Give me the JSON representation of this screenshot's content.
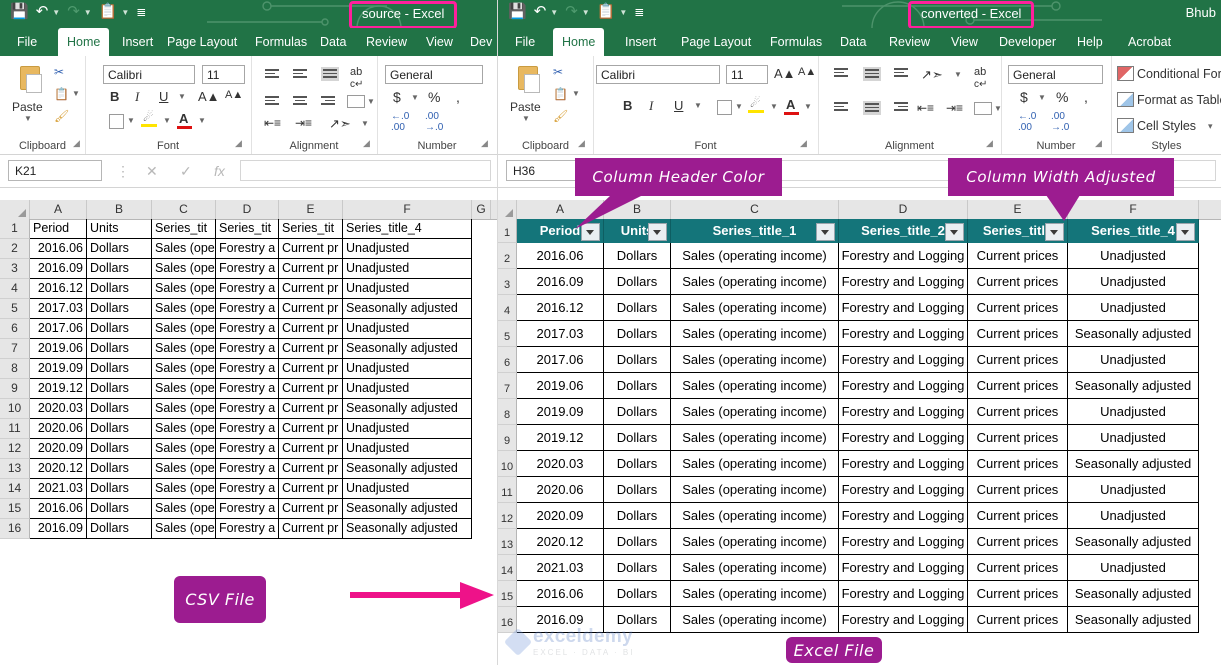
{
  "left_window": {
    "title": "source  -  Excel",
    "quick_access": [
      "save-icon",
      "undo-icon",
      "redo-icon",
      "paste-icon",
      "customize-icon"
    ],
    "tabs": [
      {
        "label": "File",
        "active": false
      },
      {
        "label": "Home",
        "active": true
      },
      {
        "label": "Insert",
        "active": false
      },
      {
        "label": "Page Layout",
        "active": false
      },
      {
        "label": "Formulas",
        "active": false
      },
      {
        "label": "Data",
        "active": false
      },
      {
        "label": "Review",
        "active": false
      },
      {
        "label": "View",
        "active": false
      },
      {
        "label": "Dev",
        "active": false
      }
    ],
    "ribbon_groups": [
      "Clipboard",
      "Font",
      "Alignment",
      "Number"
    ],
    "paste_label": "Paste",
    "font_name": "Calibri",
    "font_size": "11",
    "number_format": "General",
    "name_box": "K21",
    "formula_value": "",
    "columns": [
      "A",
      "B",
      "C",
      "D",
      "E",
      "F",
      "G"
    ],
    "row_numbers": [
      "1",
      "2",
      "3",
      "4",
      "5",
      "6",
      "7",
      "8",
      "9",
      "10",
      "11",
      "12",
      "13",
      "14",
      "15",
      "16"
    ],
    "rows": [
      [
        "Period",
        "Units",
        "Series_tit",
        "Series_tit",
        "Series_tit",
        "Series_title_4"
      ],
      [
        "2016.06",
        "Dollars",
        "Sales (ope",
        "Forestry a",
        "Current pr",
        "Unadjusted"
      ],
      [
        "2016.09",
        "Dollars",
        "Sales (ope",
        "Forestry a",
        "Current pr",
        "Unadjusted"
      ],
      [
        "2016.12",
        "Dollars",
        "Sales (ope",
        "Forestry a",
        "Current pr",
        "Unadjusted"
      ],
      [
        "2017.03",
        "Dollars",
        "Sales (ope",
        "Forestry a",
        "Current pr",
        "Seasonally adjusted"
      ],
      [
        "2017.06",
        "Dollars",
        "Sales (ope",
        "Forestry a",
        "Current pr",
        "Unadjusted"
      ],
      [
        "2019.06",
        "Dollars",
        "Sales (ope",
        "Forestry a",
        "Current pr",
        "Seasonally adjusted"
      ],
      [
        "2019.09",
        "Dollars",
        "Sales (ope",
        "Forestry a",
        "Current pr",
        "Unadjusted"
      ],
      [
        "2019.12",
        "Dollars",
        "Sales (ope",
        "Forestry a",
        "Current pr",
        "Unadjusted"
      ],
      [
        "2020.03",
        "Dollars",
        "Sales (ope",
        "Forestry a",
        "Current pr",
        "Seasonally adjusted"
      ],
      [
        "2020.06",
        "Dollars",
        "Sales (ope",
        "Forestry a",
        "Current pr",
        "Unadjusted"
      ],
      [
        "2020.09",
        "Dollars",
        "Sales (ope",
        "Forestry a",
        "Current pr",
        "Unadjusted"
      ],
      [
        "2020.12",
        "Dollars",
        "Sales (ope",
        "Forestry a",
        "Current pr",
        "Seasonally adjusted"
      ],
      [
        "2021.03",
        "Dollars",
        "Sales (ope",
        "Forestry a",
        "Current pr",
        "Unadjusted"
      ],
      [
        "2016.06",
        "Dollars",
        "Sales (ope",
        "Forestry a",
        "Current pr",
        "Seasonally adjusted"
      ],
      [
        "2016.09",
        "Dollars",
        "Sales (ope",
        "Forestry a",
        "Current pr",
        "Seasonally adjusted"
      ]
    ],
    "csv_label": "CSV File"
  },
  "right_window": {
    "title": "converted  -  Excel",
    "user_label": "Bhub",
    "tabs": [
      {
        "label": "File",
        "active": false
      },
      {
        "label": "Home",
        "active": true
      },
      {
        "label": "Insert",
        "active": false
      },
      {
        "label": "Page Layout",
        "active": false
      },
      {
        "label": "Formulas",
        "active": false
      },
      {
        "label": "Data",
        "active": false
      },
      {
        "label": "Review",
        "active": false
      },
      {
        "label": "View",
        "active": false
      },
      {
        "label": "Developer",
        "active": false
      },
      {
        "label": "Help",
        "active": false
      },
      {
        "label": "Acrobat",
        "active": false
      }
    ],
    "ribbon_groups": [
      "Clipboard",
      "Font",
      "Alignment",
      "Number",
      "Styles"
    ],
    "paste_label": "Paste",
    "font_name": "Calibri",
    "font_size": "11",
    "number_format": "General",
    "styles_items": [
      "Conditional Form",
      "Format as Table",
      "Cell Styles"
    ],
    "name_box": "H36",
    "formula_value": "",
    "columns": [
      "A",
      "B",
      "C",
      "D",
      "E",
      "F"
    ],
    "row_numbers": [
      "1",
      "2",
      "3",
      "4",
      "5",
      "6",
      "7",
      "8",
      "9",
      "10",
      "11",
      "12",
      "13",
      "14",
      "15",
      "16"
    ],
    "header_row": [
      "Period",
      "Units",
      "Series_title_1",
      "Series_title_2",
      "Series_title",
      "Series_title_4"
    ],
    "rows": [
      [
        "2016.06",
        "Dollars",
        "Sales (operating income)",
        "Forestry and Logging",
        "Current prices",
        "Unadjusted"
      ],
      [
        "2016.09",
        "Dollars",
        "Sales (operating income)",
        "Forestry and Logging",
        "Current prices",
        "Unadjusted"
      ],
      [
        "2016.12",
        "Dollars",
        "Sales (operating income)",
        "Forestry and Logging",
        "Current prices",
        "Unadjusted"
      ],
      [
        "2017.03",
        "Dollars",
        "Sales (operating income)",
        "Forestry and Logging",
        "Current prices",
        "Seasonally adjusted"
      ],
      [
        "2017.06",
        "Dollars",
        "Sales (operating income)",
        "Forestry and Logging",
        "Current prices",
        "Unadjusted"
      ],
      [
        "2019.06",
        "Dollars",
        "Sales (operating income)",
        "Forestry and Logging",
        "Current prices",
        "Seasonally adjusted"
      ],
      [
        "2019.09",
        "Dollars",
        "Sales (operating income)",
        "Forestry and Logging",
        "Current prices",
        "Unadjusted"
      ],
      [
        "2019.12",
        "Dollars",
        "Sales (operating income)",
        "Forestry and Logging",
        "Current prices",
        "Unadjusted"
      ],
      [
        "2020.03",
        "Dollars",
        "Sales (operating income)",
        "Forestry and Logging",
        "Current prices",
        "Seasonally adjusted"
      ],
      [
        "2020.06",
        "Dollars",
        "Sales (operating income)",
        "Forestry and Logging",
        "Current prices",
        "Unadjusted"
      ],
      [
        "2020.09",
        "Dollars",
        "Sales (operating income)",
        "Forestry and Logging",
        "Current prices",
        "Unadjusted"
      ],
      [
        "2020.12",
        "Dollars",
        "Sales (operating income)",
        "Forestry and Logging",
        "Current prices",
        "Seasonally adjusted"
      ],
      [
        "2021.03",
        "Dollars",
        "Sales (operating income)",
        "Forestry and Logging",
        "Current prices",
        "Unadjusted"
      ],
      [
        "2016.06",
        "Dollars",
        "Sales (operating income)",
        "Forestry and Logging",
        "Current prices",
        "Seasonally adjusted"
      ],
      [
        "2016.09",
        "Dollars",
        "Sales (operating income)",
        "Forestry and Logging",
        "Current prices",
        "Seasonally adjusted"
      ]
    ],
    "callout_header": "Column Header Color",
    "callout_width": "Column Width Adjusted",
    "excel_label": "Excel File"
  },
  "watermark": {
    "name": "exceldemy",
    "sub": "EXCEL · DATA · BI"
  },
  "colors": {
    "excel_green": "#217346",
    "header_teal": "#14757a",
    "callout_purple": "#9c1c90",
    "highlight_pink": "#ff1f9c",
    "arrow_pink": "#ee1289"
  }
}
